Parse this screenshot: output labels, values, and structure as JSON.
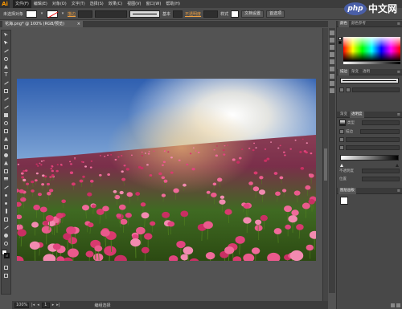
{
  "app": {
    "logo": "Ai",
    "menus": [
      "文件(F)",
      "编辑(E)",
      "对象(O)",
      "文字(T)",
      "选择(S)",
      "效果(C)",
      "视图(V)",
      "窗口(W)",
      "帮助(H)"
    ],
    "window_controls": [
      "–",
      "□",
      "×"
    ]
  },
  "watermark": {
    "logo": "php",
    "text": "中文网"
  },
  "control": {
    "selection_label": "未选择对象",
    "stroke_label": "描边",
    "stroke_value": "",
    "uniform": "基本",
    "opacity_label": "不透明度",
    "style_label": "样式",
    "doc_setup": "文档设置",
    "preferences": "首选项"
  },
  "document": {
    "tab_title": "花海.png* @ 100% (RGB/预览)",
    "close": "×"
  },
  "status": {
    "zoom": "100%",
    "page": "1",
    "text": "编组选择"
  },
  "panels": {
    "color_tabs": [
      "颜色",
      "颜色参考"
    ],
    "stroke_tabs": [
      "描边",
      "渐变",
      "透明"
    ],
    "gradient_tabs": [
      "渐变",
      "透明度"
    ],
    "gradient_type_label": "类型",
    "stroke_label": "描边",
    "angle_label": "",
    "opacity_label": "不透明度",
    "position_label": "位置",
    "layers_tabs": [
      "图层画板"
    ],
    "menu_glyph": "≡"
  },
  "colors": {
    "accent": "#ff9a00",
    "ui_dark": "#3c3c3c",
    "canvas": "#535353"
  },
  "icons": [
    "selection-arrow-icon",
    "direct-selection-icon",
    "magic-wand-icon",
    "lasso-icon",
    "pen-icon",
    "type-icon",
    "line-icon",
    "rectangle-icon",
    "paintbrush-icon",
    "pencil-icon",
    "eraser-icon",
    "rotate-icon",
    "scale-icon",
    "width-icon",
    "free-transform-icon",
    "shape-builder-icon",
    "perspective-icon",
    "mesh-icon",
    "gradient-icon",
    "eyedropper-icon",
    "blend-icon",
    "symbol-sprayer-icon",
    "graph-icon",
    "artboard-icon",
    "slice-icon",
    "hand-icon",
    "zoom-icon"
  ]
}
